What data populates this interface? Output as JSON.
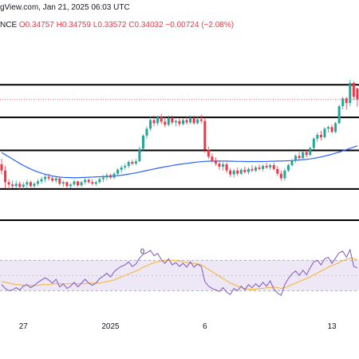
{
  "header": {
    "source_line": "gView.com, Jan 21, 2025 06:03 UTC",
    "symbol_fragment": "NCE",
    "open": "O0.34757",
    "high": "H0.34759",
    "low": "L0.33572",
    "close": "C0.34032",
    "change": "−0.00724 (−2.08%)"
  },
  "rsi_label": "0",
  "colors": {
    "up": "#26a69a",
    "down": "#f23645",
    "ma": "#2962ff",
    "rsi": "#7e57c2",
    "rsi_ma": "#f7b329",
    "rsi_band": "#ede7f6",
    "level": "#000000"
  },
  "chart_data": {
    "type": "candlestick",
    "x_tick_labels": [
      {
        "label": "27",
        "index": 6
      },
      {
        "label": "2025",
        "index": 30
      },
      {
        "label": "6",
        "index": 56
      },
      {
        "label": "13",
        "index": 91
      }
    ],
    "ohlc": [
      [
        0.2985,
        0.302,
        0.292,
        0.2945
      ],
      [
        0.2945,
        0.2975,
        0.283,
        0.287
      ],
      [
        0.287,
        0.289,
        0.2825,
        0.2855
      ],
      [
        0.2855,
        0.288,
        0.283,
        0.2845
      ],
      [
        0.2845,
        0.288,
        0.283,
        0.286
      ],
      [
        0.286,
        0.2875,
        0.282,
        0.284
      ],
      [
        0.284,
        0.287,
        0.2825,
        0.2855
      ],
      [
        0.2855,
        0.2885,
        0.2835,
        0.287
      ],
      [
        0.287,
        0.288,
        0.2835,
        0.2845
      ],
      [
        0.2845,
        0.287,
        0.283,
        0.286
      ],
      [
        0.286,
        0.289,
        0.2845,
        0.2875
      ],
      [
        0.2875,
        0.2905,
        0.286,
        0.289
      ],
      [
        0.289,
        0.292,
        0.287,
        0.2905
      ],
      [
        0.2905,
        0.2925,
        0.288,
        0.2895
      ],
      [
        0.2895,
        0.291,
        0.287,
        0.288
      ],
      [
        0.288,
        0.2905,
        0.2865,
        0.2895
      ],
      [
        0.2895,
        0.29,
        0.285,
        0.286
      ],
      [
        0.286,
        0.288,
        0.284,
        0.287
      ],
      [
        0.287,
        0.2875,
        0.2835,
        0.2845
      ],
      [
        0.2845,
        0.2865,
        0.283,
        0.2855
      ],
      [
        0.2855,
        0.2885,
        0.2845,
        0.2875
      ],
      [
        0.2875,
        0.288,
        0.284,
        0.285
      ],
      [
        0.285,
        0.288,
        0.284,
        0.287
      ],
      [
        0.287,
        0.29,
        0.2855,
        0.2885
      ],
      [
        0.2885,
        0.2895,
        0.286,
        0.287
      ],
      [
        0.287,
        0.289,
        0.285,
        0.286
      ],
      [
        0.286,
        0.288,
        0.2845,
        0.287
      ],
      [
        0.287,
        0.29,
        0.286,
        0.289
      ],
      [
        0.289,
        0.2915,
        0.287,
        0.29
      ],
      [
        0.29,
        0.293,
        0.288,
        0.2915
      ],
      [
        0.2915,
        0.2925,
        0.289,
        0.29
      ],
      [
        0.29,
        0.2935,
        0.289,
        0.2925
      ],
      [
        0.2925,
        0.296,
        0.291,
        0.295
      ],
      [
        0.295,
        0.298,
        0.293,
        0.2965
      ],
      [
        0.2965,
        0.299,
        0.295,
        0.2975
      ],
      [
        0.2975,
        0.301,
        0.296,
        0.3
      ],
      [
        0.3,
        0.3015,
        0.298,
        0.299
      ],
      [
        0.299,
        0.302,
        0.298,
        0.3005
      ],
      [
        0.3005,
        0.31,
        0.3,
        0.3085
      ],
      [
        0.3085,
        0.318,
        0.3075,
        0.317
      ],
      [
        0.317,
        0.323,
        0.315,
        0.3215
      ],
      [
        0.3215,
        0.329,
        0.32,
        0.327
      ],
      [
        0.327,
        0.33,
        0.323,
        0.325
      ],
      [
        0.325,
        0.33,
        0.3235,
        0.329
      ],
      [
        0.329,
        0.331,
        0.3245,
        0.326
      ],
      [
        0.326,
        0.329,
        0.3225,
        0.324
      ],
      [
        0.324,
        0.33,
        0.323,
        0.3285
      ],
      [
        0.3285,
        0.33,
        0.324,
        0.3255
      ],
      [
        0.3255,
        0.3275,
        0.323,
        0.3265
      ],
      [
        0.3265,
        0.328,
        0.323,
        0.3245
      ],
      [
        0.3245,
        0.3285,
        0.3235,
        0.327
      ],
      [
        0.327,
        0.329,
        0.324,
        0.3255
      ],
      [
        0.3255,
        0.33,
        0.3245,
        0.3285
      ],
      [
        0.3285,
        0.33,
        0.324,
        0.325
      ],
      [
        0.325,
        0.329,
        0.324,
        0.3275
      ],
      [
        0.3275,
        0.3305,
        0.325,
        0.3265
      ],
      [
        0.3265,
        0.3285,
        0.306,
        0.308
      ],
      [
        0.308,
        0.31,
        0.302,
        0.3035
      ],
      [
        0.3035,
        0.3055,
        0.2995,
        0.301
      ],
      [
        0.301,
        0.303,
        0.2975,
        0.299
      ],
      [
        0.299,
        0.301,
        0.295,
        0.297
      ],
      [
        0.297,
        0.3,
        0.2945,
        0.2985
      ],
      [
        0.2985,
        0.3,
        0.293,
        0.2945
      ],
      [
        0.2945,
        0.296,
        0.2905,
        0.292
      ],
      [
        0.292,
        0.2955,
        0.29,
        0.2945
      ],
      [
        0.2945,
        0.2965,
        0.291,
        0.2925
      ],
      [
        0.2925,
        0.296,
        0.2915,
        0.295
      ],
      [
        0.295,
        0.297,
        0.2925,
        0.2935
      ],
      [
        0.2935,
        0.2965,
        0.292,
        0.2955
      ],
      [
        0.2955,
        0.298,
        0.2935,
        0.2945
      ],
      [
        0.2945,
        0.2975,
        0.2935,
        0.2965
      ],
      [
        0.2965,
        0.2985,
        0.2945,
        0.2955
      ],
      [
        0.2955,
        0.2985,
        0.294,
        0.2975
      ],
      [
        0.2975,
        0.2995,
        0.2955,
        0.2965
      ],
      [
        0.2965,
        0.299,
        0.295,
        0.298
      ],
      [
        0.298,
        0.2995,
        0.2945,
        0.2955
      ],
      [
        0.2955,
        0.2975,
        0.291,
        0.2925
      ],
      [
        0.2925,
        0.2945,
        0.288,
        0.2895
      ],
      [
        0.2895,
        0.296,
        0.288,
        0.2945
      ],
      [
        0.2945,
        0.299,
        0.2935,
        0.298
      ],
      [
        0.298,
        0.302,
        0.297,
        0.301
      ],
      [
        0.301,
        0.305,
        0.2995,
        0.304
      ],
      [
        0.304,
        0.3065,
        0.301,
        0.3025
      ],
      [
        0.3025,
        0.3075,
        0.3015,
        0.3065
      ],
      [
        0.3065,
        0.308,
        0.303,
        0.3045
      ],
      [
        0.3045,
        0.31,
        0.304,
        0.309
      ],
      [
        0.309,
        0.316,
        0.308,
        0.315
      ],
      [
        0.315,
        0.319,
        0.313,
        0.3175
      ],
      [
        0.3175,
        0.32,
        0.314,
        0.316
      ],
      [
        0.316,
        0.3225,
        0.315,
        0.3215
      ],
      [
        0.3215,
        0.3235,
        0.319,
        0.3225
      ],
      [
        0.3225,
        0.324,
        0.3185,
        0.3195
      ],
      [
        0.3195,
        0.326,
        0.3185,
        0.325
      ],
      [
        0.325,
        0.337,
        0.3245,
        0.336
      ],
      [
        0.336,
        0.342,
        0.334,
        0.341
      ],
      [
        0.341,
        0.342,
        0.334,
        0.338
      ],
      [
        0.338,
        0.353,
        0.336,
        0.351
      ],
      [
        0.351,
        0.352,
        0.34,
        0.342
      ],
      [
        0.3475,
        0.3476,
        0.3357,
        0.3403
      ]
    ],
    "moving_average": [
      0.3061,
      0.3047,
      0.3033,
      0.3019,
      0.3005,
      0.2991,
      0.2978,
      0.2966,
      0.2955,
      0.2945,
      0.2936,
      0.2928,
      0.2921,
      0.2915,
      0.291,
      0.2906,
      0.2903,
      0.2901,
      0.29,
      0.2899,
      0.2899,
      0.2899,
      0.29,
      0.2901,
      0.2902,
      0.2903,
      0.2904,
      0.2905,
      0.2906,
      0.2907,
      0.2908,
      0.291,
      0.2912,
      0.2915,
      0.2918,
      0.2922,
      0.2926,
      0.293,
      0.2935,
      0.294,
      0.2945,
      0.295,
      0.2955,
      0.296,
      0.2965,
      0.2969,
      0.2973,
      0.2977,
      0.2981,
      0.2985,
      0.2988,
      0.2991,
      0.2994,
      0.2997,
      0.3,
      0.3002,
      0.3004,
      0.3005,
      0.3006,
      0.3006,
      0.3006,
      0.3006,
      0.3006,
      0.3005,
      0.3005,
      0.3004,
      0.3004,
      0.3003,
      0.3003,
      0.3003,
      0.3003,
      0.3003,
      0.3003,
      0.3004,
      0.3005,
      0.3005,
      0.3006,
      0.3006,
      0.3007,
      0.3008,
      0.3009,
      0.3011,
      0.3013,
      0.3015,
      0.3017,
      0.302,
      0.3024,
      0.3028,
      0.3033,
      0.3038,
      0.3044,
      0.305,
      0.3057,
      0.3064,
      0.3072,
      0.308,
      0.3088,
      0.3096,
      0.3104
    ],
    "price_levels": [
      0.3498,
      0.3288,
      0.3075,
      0.2826,
      0.2625
    ],
    "rsi": [
      38,
      33,
      30,
      31,
      34,
      31,
      36,
      38,
      34,
      37,
      41,
      44,
      47,
      44,
      40,
      45,
      35,
      39,
      33,
      36,
      41,
      35,
      40,
      45,
      40,
      37,
      40,
      46,
      49,
      53,
      48,
      55,
      59,
      62,
      64,
      68,
      62,
      65,
      73,
      78,
      80,
      83,
      76,
      79,
      71,
      66,
      72,
      64,
      67,
      62,
      66,
      61,
      68,
      61,
      65,
      62,
      42,
      36,
      33,
      31,
      29,
      34,
      28,
      25,
      33,
      30,
      36,
      31,
      38,
      34,
      39,
      35,
      41,
      36,
      43,
      32,
      27,
      24,
      38,
      46,
      52,
      56,
      50,
      57,
      51,
      60,
      68,
      70,
      64,
      72,
      74,
      66,
      73,
      80,
      82,
      74,
      84,
      62,
      60
    ],
    "rsi_ma": [
      42,
      41,
      40,
      39,
      38,
      38,
      37,
      37,
      37,
      37,
      37,
      38,
      38,
      38,
      39,
      39,
      39,
      39,
      39,
      39,
      39,
      39,
      39,
      39,
      40,
      40,
      40,
      40,
      41,
      42,
      43,
      44,
      46,
      48,
      50,
      52,
      54,
      56,
      58,
      61,
      63,
      65,
      67,
      68,
      69,
      70,
      70,
      70,
      70,
      69,
      68,
      67,
      66,
      66,
      65,
      64,
      61,
      58,
      55,
      52,
      49,
      46,
      43,
      40,
      38,
      36,
      34,
      33,
      32,
      32,
      32,
      33,
      33,
      34,
      34,
      35,
      34,
      33,
      34,
      36,
      38,
      40,
      42,
      44,
      46,
      48,
      51,
      53,
      56,
      58,
      61,
      63,
      65,
      67,
      70,
      71,
      73,
      72,
      71
    ],
    "rsi_band": [
      30,
      70
    ],
    "rsi_mid": 50
  }
}
